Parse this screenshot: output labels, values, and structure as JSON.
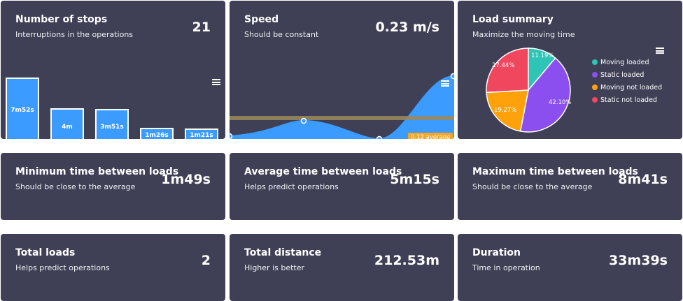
{
  "stops": {
    "title": "Number of stops",
    "subtitle": "Interruptions in the operations",
    "value": "21",
    "bars": [
      "7m52s",
      "4m",
      "3m51s",
      "1m26s",
      "1m21s"
    ]
  },
  "speed": {
    "title": "Speed",
    "subtitle": "Should be constant",
    "value": "0.23 m/s",
    "average_label": "0.12 average"
  },
  "load": {
    "title": "Load summary",
    "subtitle": "Maximize the moving time",
    "slices": [
      {
        "label": "Moving loaded",
        "pct": "11.19%",
        "color": "#2ec4b6"
      },
      {
        "label": "Static loaded",
        "pct": "42.10%",
        "color": "#8b4ff0"
      },
      {
        "label": "Moving not loaded",
        "pct": "19.27%",
        "color": "#ffa10a"
      },
      {
        "label": "Static not loaded",
        "pct": "27.44%",
        "color": "#f0475f"
      }
    ]
  },
  "min_time": {
    "title": "Minimum time between loads",
    "subtitle": "Should be close to the average",
    "value": "1m49s"
  },
  "avg_time": {
    "title": "Average time between loads",
    "subtitle": "Helps predict operations",
    "value": "5m15s"
  },
  "max_time": {
    "title": "Maximum time between loads",
    "subtitle": "Should be close to the average",
    "value": "8m41s"
  },
  "total_loads": {
    "title": "Total loads",
    "subtitle": "Helps predict operations",
    "value": "2"
  },
  "total_distance": {
    "title": "Total distance",
    "subtitle": "Higher is better",
    "value": "212.53m"
  },
  "duration": {
    "title": "Duration",
    "subtitle": "Time in operation",
    "value": "33m39s"
  },
  "colors": {
    "card": "#3f4055",
    "bar": "#3b9bff",
    "average": "#f5a623"
  },
  "icons": {
    "menu": "hamburger-menu-icon"
  }
}
